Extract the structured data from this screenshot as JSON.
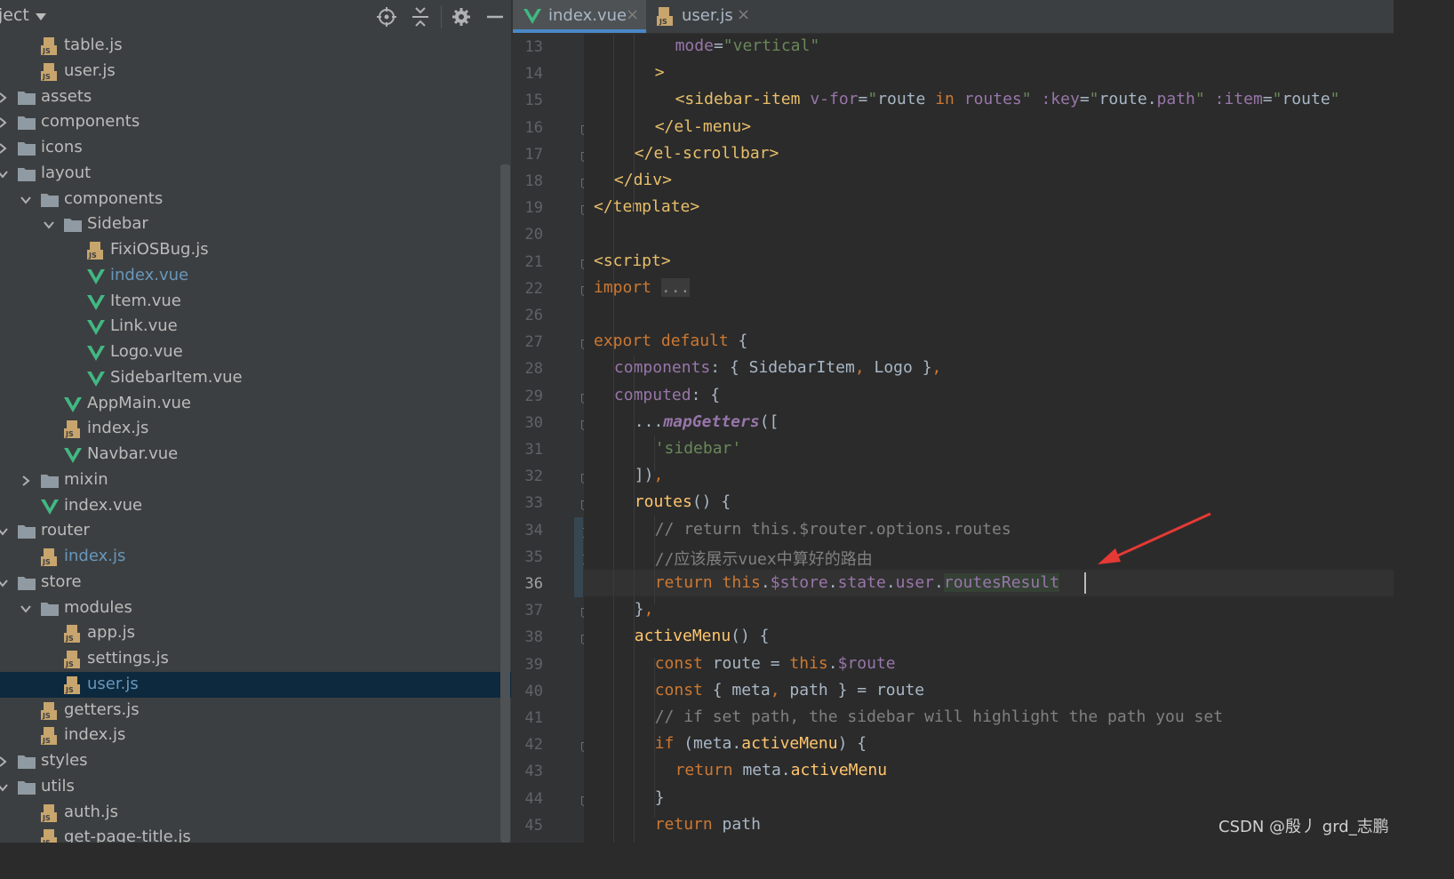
{
  "project_panel": {
    "title": "ject",
    "tree": [
      {
        "label": "table.js",
        "type": "js",
        "depth": 1
      },
      {
        "label": "user.js",
        "type": "js",
        "depth": 1
      },
      {
        "label": "assets",
        "type": "folder",
        "depth": 0,
        "arrow": "right"
      },
      {
        "label": "components",
        "type": "folder",
        "depth": 0,
        "arrow": "right"
      },
      {
        "label": "icons",
        "type": "folder",
        "depth": 0,
        "arrow": "right"
      },
      {
        "label": "layout",
        "type": "folder",
        "depth": 0,
        "arrow": "down"
      },
      {
        "label": "components",
        "type": "folder",
        "depth": 1,
        "arrow": "down"
      },
      {
        "label": "Sidebar",
        "type": "folder",
        "depth": 2,
        "arrow": "down"
      },
      {
        "label": "FixiOSBug.js",
        "type": "js",
        "depth": 3
      },
      {
        "label": "index.vue",
        "type": "vue",
        "depth": 3,
        "highlight": true
      },
      {
        "label": "Item.vue",
        "type": "vue",
        "depth": 3
      },
      {
        "label": "Link.vue",
        "type": "vue",
        "depth": 3
      },
      {
        "label": "Logo.vue",
        "type": "vue",
        "depth": 3
      },
      {
        "label": "SidebarItem.vue",
        "type": "vue",
        "depth": 3
      },
      {
        "label": "AppMain.vue",
        "type": "vue",
        "depth": 2
      },
      {
        "label": "index.js",
        "type": "js",
        "depth": 2
      },
      {
        "label": "Navbar.vue",
        "type": "vue",
        "depth": 2
      },
      {
        "label": "mixin",
        "type": "folder",
        "depth": 1,
        "arrow": "right"
      },
      {
        "label": "index.vue",
        "type": "vue",
        "depth": 1
      },
      {
        "label": "router",
        "type": "folder",
        "depth": 0,
        "arrow": "down"
      },
      {
        "label": "index.js",
        "type": "js",
        "depth": 1,
        "highlight": true
      },
      {
        "label": "store",
        "type": "folder",
        "depth": 0,
        "arrow": "down"
      },
      {
        "label": "modules",
        "type": "folder",
        "depth": 1,
        "arrow": "down"
      },
      {
        "label": "app.js",
        "type": "js",
        "depth": 2
      },
      {
        "label": "settings.js",
        "type": "js",
        "depth": 2
      },
      {
        "label": "user.js",
        "type": "js",
        "depth": 2,
        "highlight": true,
        "selected": true
      },
      {
        "label": "getters.js",
        "type": "js",
        "depth": 1
      },
      {
        "label": "index.js",
        "type": "js",
        "depth": 1
      },
      {
        "label": "styles",
        "type": "folder",
        "depth": 0,
        "arrow": "right"
      },
      {
        "label": "utils",
        "type": "folder",
        "depth": 0,
        "arrow": "down"
      },
      {
        "label": "auth.js",
        "type": "js",
        "depth": 1
      },
      {
        "label": "get-page-title.js",
        "type": "js",
        "depth": 1
      }
    ]
  },
  "tabs": [
    {
      "label": "index.vue",
      "icon": "vue-icon",
      "active": true
    },
    {
      "label": "user.js",
      "icon": "js-file-icon",
      "active": false
    }
  ],
  "editor": {
    "current_line": "36",
    "lines": [
      {
        "n": "13",
        "fold": false,
        "html": "<span class=\"p\">mode</span>=<span class=\"s\">\"vertical\"</span>",
        "indent": 4
      },
      {
        "n": "14",
        "fold": false,
        "html": "<span class=\"t\">&gt;</span>",
        "indent": 3
      },
      {
        "n": "15",
        "fold": false,
        "html": "<span class=\"t\">&lt;sidebar-item </span><span class=\"p\">v-for</span>=<span class=\"s\">\"</span>route <span class=\"k\">in</span> <span class=\"p\">routes</span><span class=\"s\">\"</span> <span class=\"p\">:key</span>=<span class=\"s\">\"</span>route.<span class=\"p\">path</span><span class=\"s\">\"</span> <span class=\"p\">:item</span>=<span class=\"s\">\"</span>route<span class=\"s\">\"</span>",
        "indent": 4
      },
      {
        "n": "16",
        "fold": true,
        "html": "<span class=\"t\">&lt;/el-menu&gt;</span>",
        "indent": 3
      },
      {
        "n": "17",
        "fold": true,
        "html": "<span class=\"t\">&lt;/el-scrollbar&gt;</span>",
        "indent": 2
      },
      {
        "n": "18",
        "fold": true,
        "html": "<span class=\"t\">&lt;/div&gt;</span>",
        "indent": 1
      },
      {
        "n": "19",
        "fold": true,
        "html": "<span class=\"t\">&lt;/template&gt;</span>",
        "indent": 0
      },
      {
        "n": "20",
        "fold": false,
        "html": "",
        "indent": 0
      },
      {
        "n": "21",
        "fold": true,
        "html": "<span class=\"t\">&lt;script&gt;</span>",
        "indent": 0
      },
      {
        "n": "22",
        "fold": true,
        "html": "<span class=\"k\">import</span> <span class=\"fold-dots\">...</span>",
        "indent": 0
      },
      {
        "n": "26",
        "fold": false,
        "html": "",
        "indent": 0
      },
      {
        "n": "27",
        "fold": true,
        "html": "<span class=\"k\">export default</span> {",
        "indent": 0
      },
      {
        "n": "28",
        "fold": false,
        "html": "<span class=\"p\">components</span>: { SidebarItem<span class=\"k\">,</span> Logo }<span class=\"k\">,</span>",
        "indent": 1
      },
      {
        "n": "29",
        "fold": true,
        "html": "<span class=\"p\">computed</span>: {",
        "indent": 1
      },
      {
        "n": "30",
        "fold": true,
        "html": "...<span class=\"it\">mapGetters</span>([",
        "indent": 2
      },
      {
        "n": "31",
        "fold": false,
        "html": "<span class=\"s\">'sidebar'</span>",
        "indent": 3
      },
      {
        "n": "32",
        "fold": true,
        "html": "])<span class=\"k\">,</span>",
        "indent": 2
      },
      {
        "n": "33",
        "fold": true,
        "html": "<span class=\"f\">routes</span>() {",
        "indent": 2
      },
      {
        "n": "34",
        "fold": true,
        "html": "<span class=\"c\">// return this.$router.options.routes</span>",
        "indent": 3
      },
      {
        "n": "35",
        "fold": true,
        "html": "<span class=\"c\">//应该展示vuex中算好的路由</span>",
        "indent": 3
      },
      {
        "n": "36",
        "fold": false,
        "html": "<span class=\"k\">return this</span>.<span class=\"p\">$store</span>.<span class=\"p\">state</span>.<span class=\"p\">user</span>.<span class=\"p hl\">routesResult</span>",
        "indent": 3
      },
      {
        "n": "37",
        "fold": true,
        "html": "}<span class=\"k\">,</span>",
        "indent": 2
      },
      {
        "n": "38",
        "fold": true,
        "html": "<span class=\"f\">activeMenu</span>() {",
        "indent": 2
      },
      {
        "n": "39",
        "fold": false,
        "html": "<span class=\"k\">const</span> route = <span class=\"k\">this</span>.<span class=\"p\">$route</span>",
        "indent": 3
      },
      {
        "n": "40",
        "fold": false,
        "html": "<span class=\"k\">const</span> { meta<span class=\"k\">,</span> path } = route",
        "indent": 3
      },
      {
        "n": "41",
        "fold": false,
        "html": "<span class=\"c\">// if set path, the sidebar will highlight the path you set</span>",
        "indent": 3
      },
      {
        "n": "42",
        "fold": true,
        "html": "<span class=\"k\">if</span> (meta.<span class=\"f\">activeMenu</span>) {",
        "indent": 3
      },
      {
        "n": "43",
        "fold": false,
        "html": "<span class=\"k\">return</span> meta.<span class=\"f\">activeMenu</span>",
        "indent": 4
      },
      {
        "n": "44",
        "fold": true,
        "html": "}",
        "indent": 3
      },
      {
        "n": "45",
        "fold": false,
        "html": "<span class=\"k\">return</span> path",
        "indent": 3
      }
    ]
  },
  "watermark": "CSDN @殷丿 grd_志鹏",
  "colors": {
    "panel_bg": "#3c3f41",
    "editor_bg": "#2b2b2b",
    "selection": "#0d293e",
    "vue_green": "#41b883",
    "folder_gray": "#8f9aa3",
    "annotation_red": "#e53935"
  }
}
